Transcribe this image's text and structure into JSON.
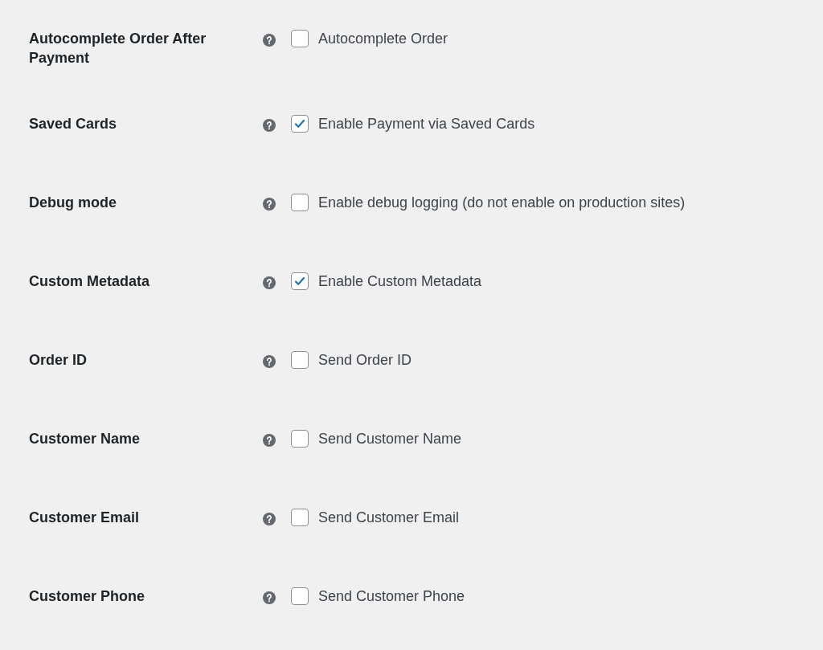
{
  "settings": [
    {
      "label": "Autocomplete Order After Payment",
      "checkbox_label": "Autocomplete Order",
      "checked": false
    },
    {
      "label": "Saved Cards",
      "checkbox_label": "Enable Payment via Saved Cards",
      "checked": true
    },
    {
      "label": "Debug mode",
      "checkbox_label": "Enable debug logging (do not enable on production sites)",
      "checked": false
    },
    {
      "label": "Custom Metadata",
      "checkbox_label": "Enable Custom Metadata",
      "checked": true
    },
    {
      "label": "Order ID",
      "checkbox_label": "Send Order ID",
      "checked": false
    },
    {
      "label": "Customer Name",
      "checkbox_label": "Send Customer Name",
      "checked": false
    },
    {
      "label": "Customer Email",
      "checkbox_label": "Send Customer Email",
      "checked": false
    },
    {
      "label": "Customer Phone",
      "checkbox_label": "Send Customer Phone",
      "checked": false
    }
  ]
}
